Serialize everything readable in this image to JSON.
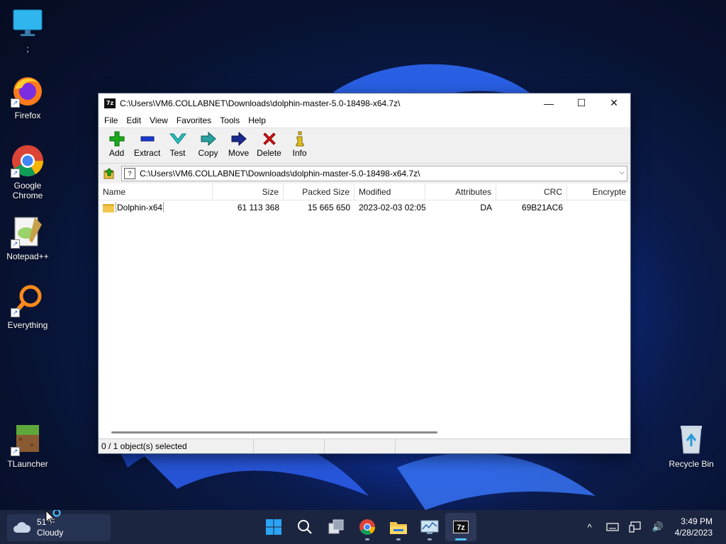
{
  "desktop": {
    "icons": [
      {
        "label": ";",
        "icon": "monitor-icon"
      },
      {
        "label": "Firefox",
        "icon": "firefox-icon"
      },
      {
        "label": "Google Chrome",
        "icon": "chrome-icon"
      },
      {
        "label": "Notepad++",
        "icon": "notepadpp-icon"
      },
      {
        "label": "Everything",
        "icon": "search-magnifier-icon"
      },
      {
        "label": "TLauncher",
        "icon": "grass-block-icon"
      },
      {
        "label": "Recycle Bin",
        "icon": "recycle-bin-icon"
      }
    ],
    "shortcut_arrow": "↗"
  },
  "window": {
    "app_icon": "7z",
    "title": "C:\\Users\\VM6.COLLABNET\\Downloads\\dolphin-master-5.0-18498-x64.7z\\",
    "controls": {
      "minimize": "—",
      "maximize": "☐",
      "close": "✕"
    },
    "menu": [
      "File",
      "Edit",
      "View",
      "Favorites",
      "Tools",
      "Help"
    ],
    "toolbar": [
      "Add",
      "Extract",
      "Test",
      "Copy",
      "Move",
      "Delete",
      "Info"
    ],
    "address": {
      "path": "C:\\Users\\VM6.COLLABNET\\Downloads\\dolphin-master-5.0-18498-x64.7z\\",
      "icon_text": "?",
      "dropdown": "⌵"
    },
    "columns": [
      "Name",
      "Size",
      "Packed Size",
      "Modified",
      "Attributes",
      "CRC",
      "Encrypte"
    ],
    "rows": [
      {
        "name": "Dolphin-x64",
        "size": "61 113 368",
        "packed": "15 665 650",
        "modified": "2023-02-03 02:05",
        "attributes": "DA",
        "crc": "69B21AC6",
        "encrypted": ""
      }
    ],
    "status": "0 / 1 object(s) selected"
  },
  "taskbar": {
    "weather": {
      "temp": "51°F",
      "condition": "Cloudy"
    },
    "apps": [
      "start-icon",
      "search-icon",
      "task-view-icon",
      "chrome-icon",
      "file-explorer-icon",
      "resource-monitor-icon",
      "7zip-icon"
    ],
    "app_7zip_text": "7z",
    "clock": {
      "time": "3:49 PM",
      "date": "4/28/2023"
    },
    "tray": {
      "chevron": "^",
      "speaker": "🔊"
    }
  },
  "colors": {
    "accent": "#4cc2ff",
    "taskbar": "#1c2540",
    "add_green": "#1aaa1a",
    "delete_red": "#d61818",
    "move_blue": "#1a2a8c"
  }
}
